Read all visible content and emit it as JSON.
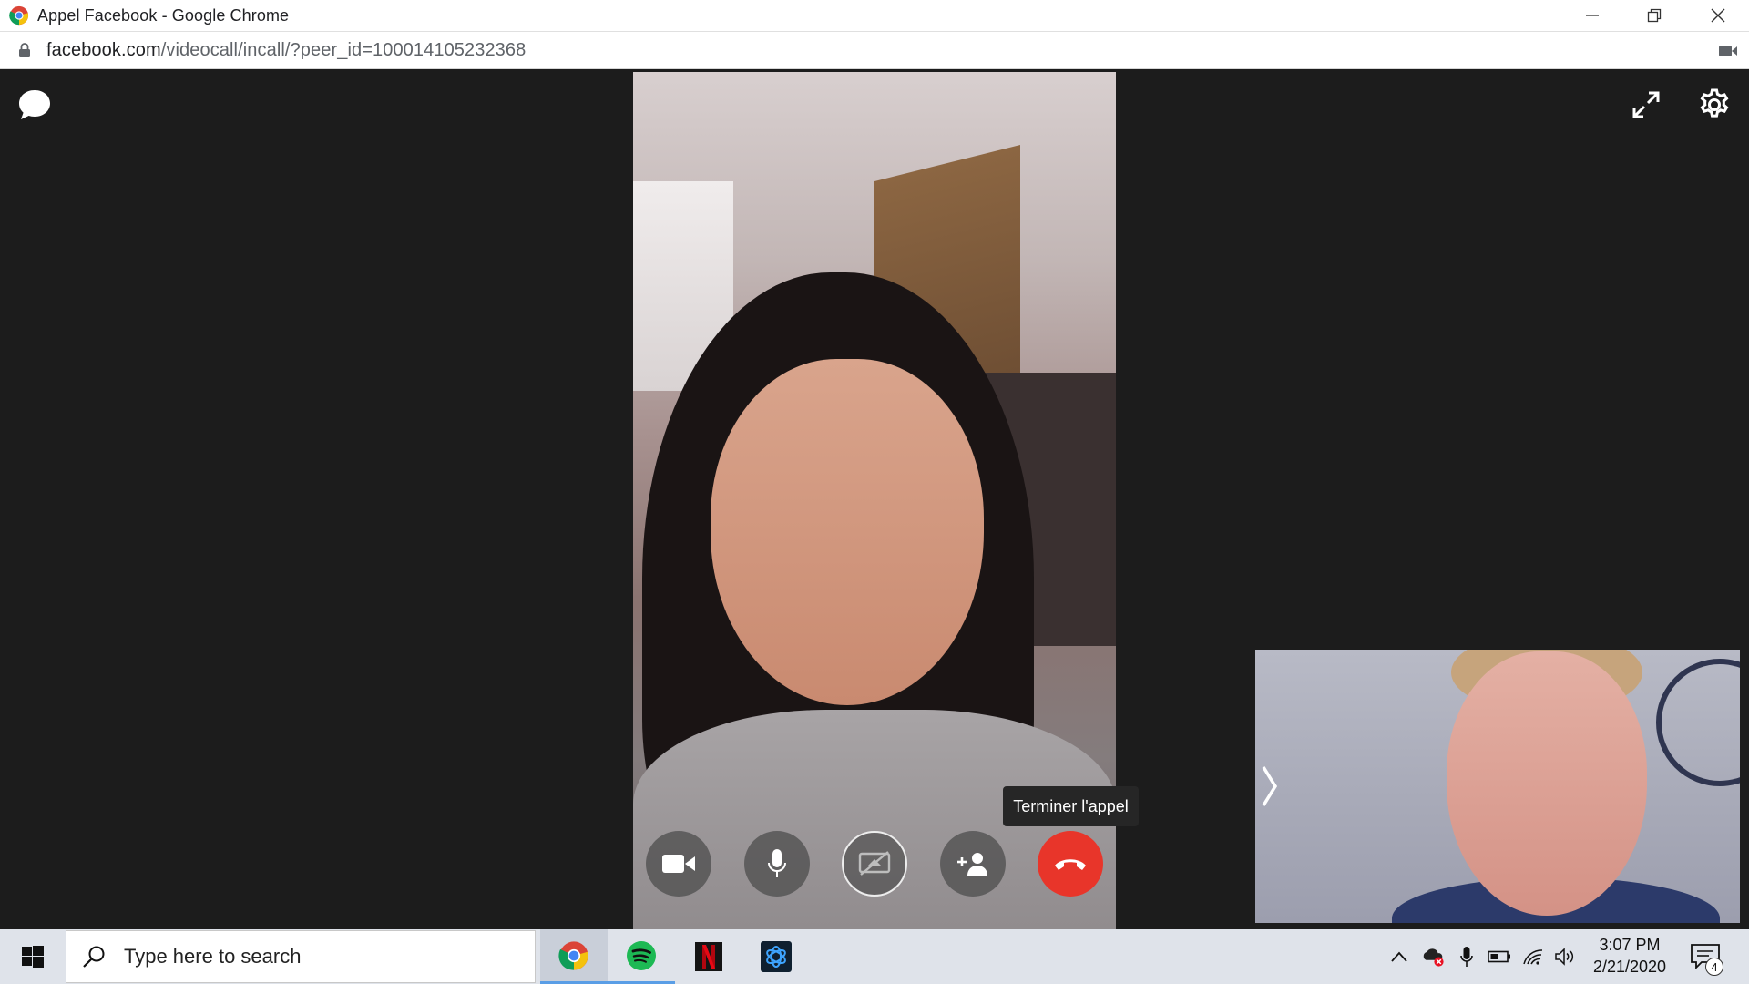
{
  "window": {
    "title": "Appel Facebook - Google Chrome"
  },
  "address": {
    "host": "facebook.com",
    "path": "/videocall/incall/?peer_id=100014105232368"
  },
  "call": {
    "end_call_tooltip": "Terminer l'appel",
    "controls": [
      {
        "name": "camera",
        "icon": "video-camera-icon"
      },
      {
        "name": "microphone",
        "icon": "microphone-icon"
      },
      {
        "name": "screen-share",
        "icon": "screen-share-icon"
      },
      {
        "name": "add-person",
        "icon": "add-person-icon"
      },
      {
        "name": "end-call",
        "icon": "hang-up-icon"
      }
    ],
    "colors": {
      "end_call": "#e8352a",
      "background": "#1c1c1c"
    }
  },
  "taskbar": {
    "search_placeholder": "Type here to search",
    "apps": [
      "Google Chrome",
      "Spotify",
      "Netflix",
      "Battle.net"
    ],
    "time": "3:07 PM",
    "date": "2/21/2020",
    "notification_count": "4"
  }
}
